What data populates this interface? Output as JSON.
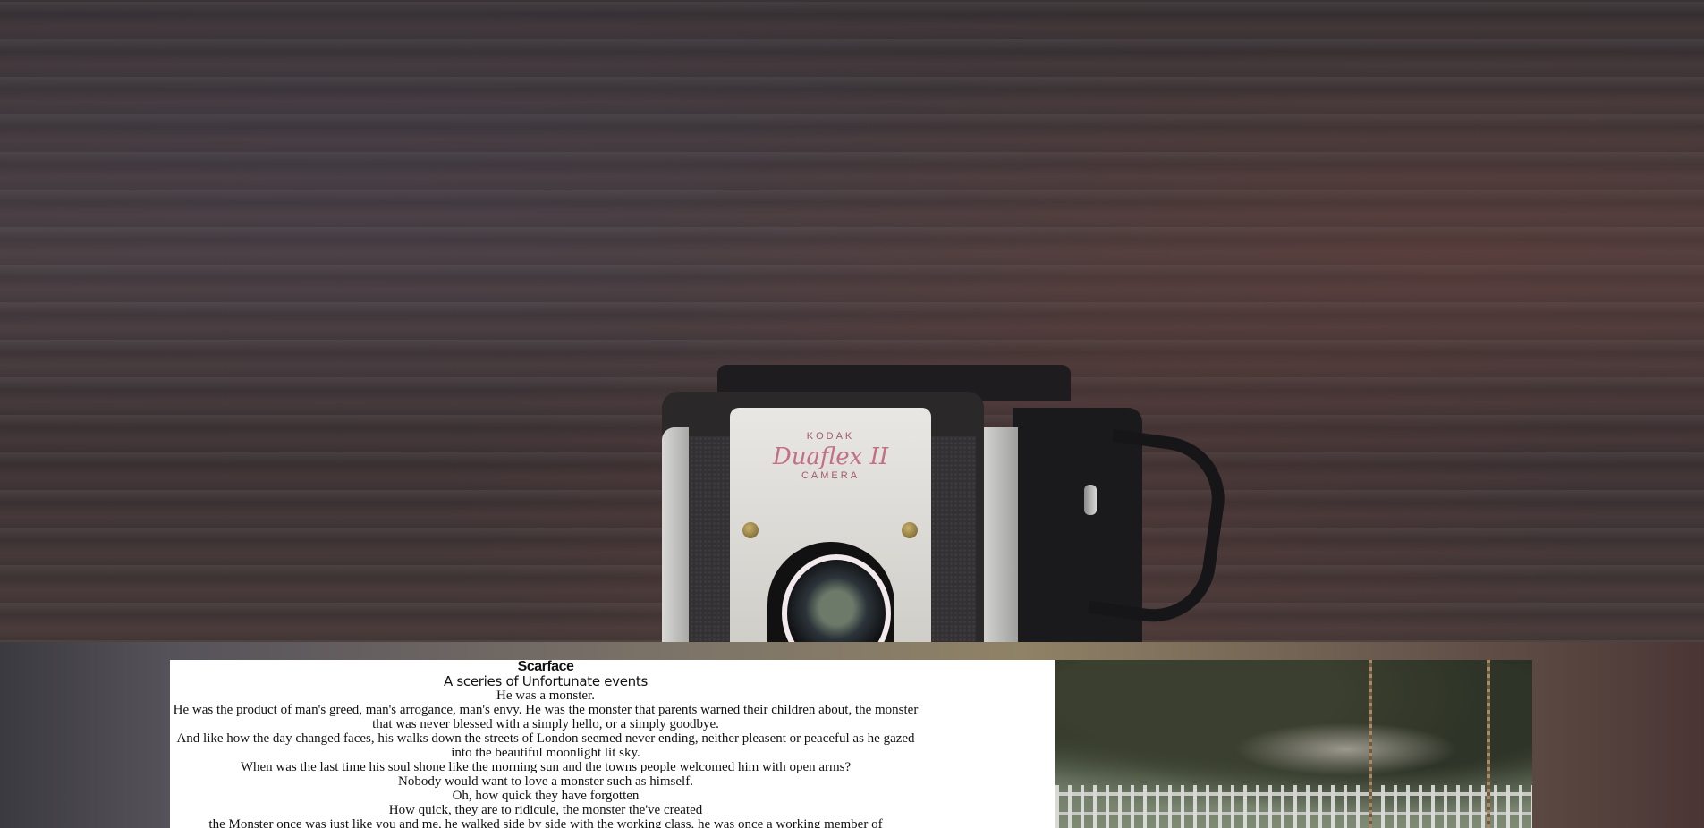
{
  "hero": {
    "camera": {
      "brand": "KODAK",
      "model": "Duaflex II",
      "label": "CAMERA"
    }
  },
  "story": {
    "title": "Scarface",
    "subtitle": "A sceries of Unfortunate events",
    "lines": [
      "He was a monster.",
      "He was the product of man's greed, man's arrogance, man's envy. He was the monster that parents warned their children about, the monster that was never blessed with a simply hello, or a simply goodbye.",
      "And like how the day changed faces, his walks down the streets of London seemed never ending, neither pleasent or peaceful as he gazed into the beautiful moonlight lit sky.",
      "When was the last time his soul shone like the morning sun and the towns people welcomed him with open arms?",
      "Nobody would want to love a monster such as himself.",
      "Oh, how quick they have forgotten",
      "How quick, they are to ridicule, the monster the've created",
      "the Monster once was just like you and me, he walked side by side with the working class, he was once a working member of"
    ]
  }
}
